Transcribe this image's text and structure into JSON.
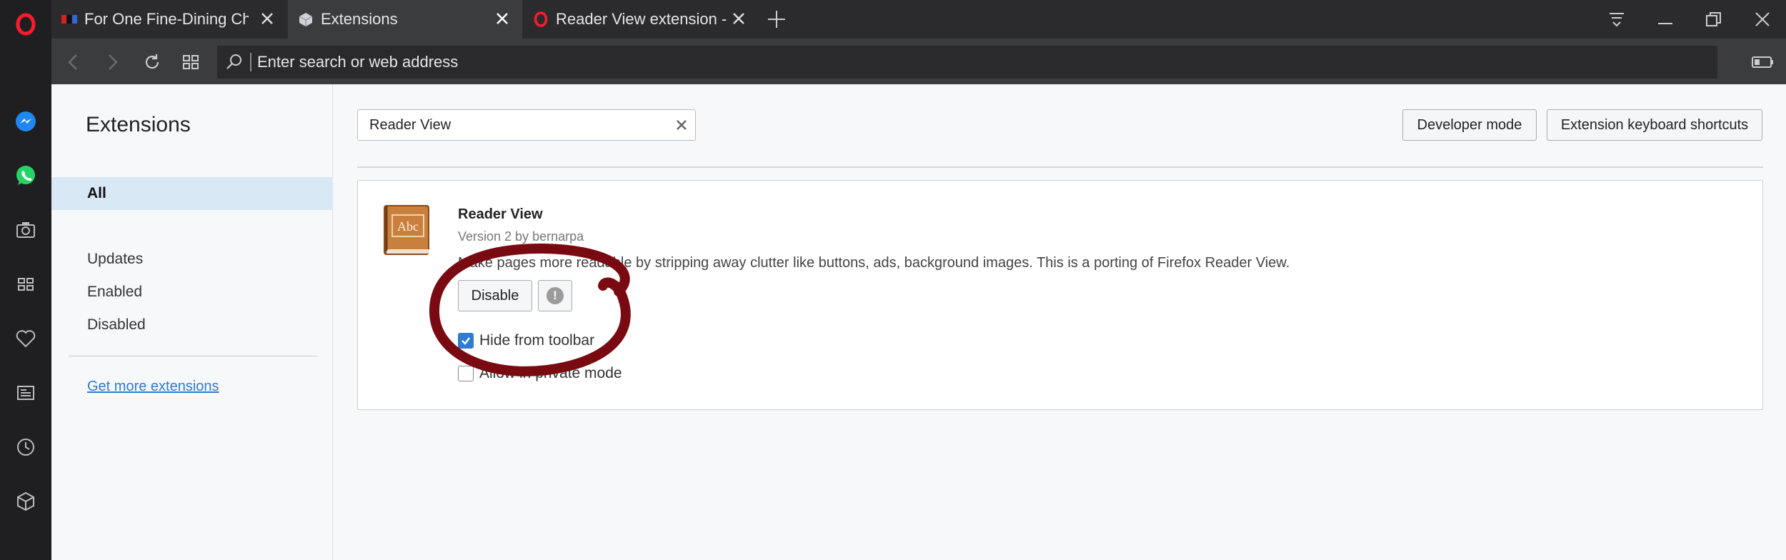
{
  "tabs": [
    {
      "title": "For One Fine-Dining Chef, Faith Forms The Founda...",
      "favicon": "npr-icon"
    },
    {
      "title": "Extensions",
      "favicon": "extensions-cube-icon"
    },
    {
      "title": "Reader View extension - Opera add-ons",
      "favicon": "opera-icon"
    }
  ],
  "address_bar": {
    "placeholder": "Enter search or web address",
    "value": ""
  },
  "sidebar": {
    "title": "Extensions",
    "items": [
      {
        "label": "All",
        "active": true
      },
      {
        "label": "Updates"
      },
      {
        "label": "Enabled"
      },
      {
        "label": "Disabled"
      }
    ],
    "more_link": "Get more extensions"
  },
  "search": {
    "value": "Reader View"
  },
  "header_buttons": {
    "developer_mode": "Developer mode",
    "shortcuts": "Extension keyboard shortcuts"
  },
  "extension": {
    "name": "Reader View",
    "version": "Version 2 by bernarpa",
    "description": "Make pages more readable by stripping away clutter like buttons, ads, background images. This is a porting of Firefox Reader View.",
    "disable_label": "Disable",
    "icon_text": "Abc",
    "hide_from_toolbar": {
      "label": "Hide from toolbar",
      "checked": true
    },
    "allow_private": {
      "label": "Allow in private mode",
      "checked": false
    }
  },
  "colors": {
    "opera_red": "#ff1b2d",
    "accent": "#2f7bd1",
    "annotation": "#7a0a12"
  }
}
